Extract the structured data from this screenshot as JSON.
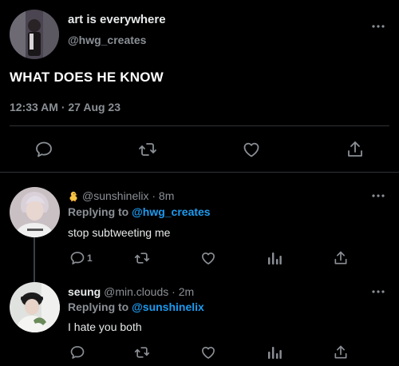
{
  "main_tweet": {
    "display_name": "art is everywhere",
    "handle": "@hwg_creates",
    "text": "WHAT DOES HE KNOW",
    "timestamp": "12:33 AM · 27 Aug 23"
  },
  "replies": [
    {
      "display_name": "",
      "handle": "@sunshinelix",
      "time": "· 8m",
      "replying_label": "Replying to",
      "replying_to": "@hwg_creates",
      "text": "stop subtweeting me",
      "reply_count": "1"
    },
    {
      "display_name": "seung",
      "handle": "@min.clouds",
      "time": "· 2m",
      "replying_label": "Replying to",
      "replying_to": "@sunshinelix",
      "text": "I hate you both"
    }
  ],
  "colors": {
    "background": "#000000",
    "text": "#e7e9ea",
    "muted": "#8b9096",
    "accent": "#1d9bf0",
    "divider": "#2f3336"
  },
  "icons": [
    "more-icon",
    "reply-icon",
    "retweet-icon",
    "like-icon",
    "share-icon",
    "views-icon",
    "chick-emoji-icon"
  ]
}
